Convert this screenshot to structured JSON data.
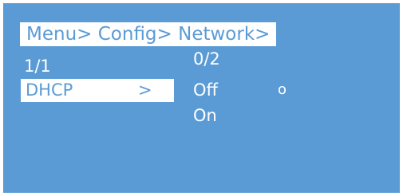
{
  "breadcrumb": "Menu> Config> Network>",
  "menu": {
    "page_indicator": "1/1",
    "items": [
      {
        "label": "DHCP",
        "arrow": ">"
      }
    ]
  },
  "options": {
    "counter": "0/2",
    "list": [
      {
        "label": "Off",
        "selected": true,
        "marker": "o"
      },
      {
        "label": "On",
        "selected": false
      }
    ]
  },
  "colors": {
    "background": "#5b9bd5",
    "highlight": "#ffffff",
    "text": "#ffffff"
  }
}
